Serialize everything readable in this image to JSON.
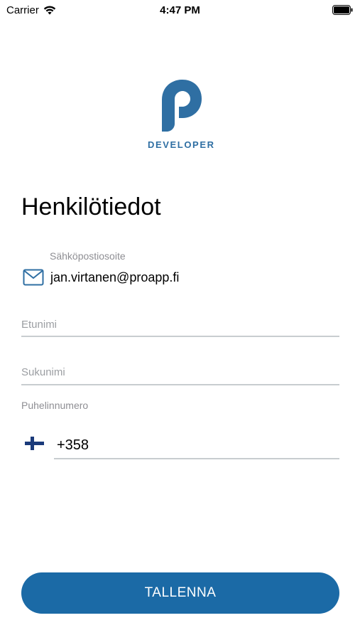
{
  "status_bar": {
    "carrier": "Carrier",
    "time": "4:47 PM",
    "icons": [
      "wifi-icon",
      "battery-icon"
    ]
  },
  "logo": {
    "text": "DEVELOPER",
    "color": "#2f6fa3"
  },
  "page": {
    "title": "Henkilötiedot"
  },
  "form": {
    "email": {
      "label": "Sähköpostiosoite",
      "value": "jan.virtanen@proapp.fi",
      "icon": "mail-icon"
    },
    "first_name": {
      "placeholder": "Etunimi",
      "value": ""
    },
    "last_name": {
      "placeholder": "Sukunimi",
      "value": ""
    },
    "phone": {
      "label": "Puhelinnumero",
      "country_flag": "finland-flag-icon",
      "value": "+358"
    }
  },
  "save_button": {
    "label": "TALLENNA",
    "color": "#1b6aa6"
  }
}
